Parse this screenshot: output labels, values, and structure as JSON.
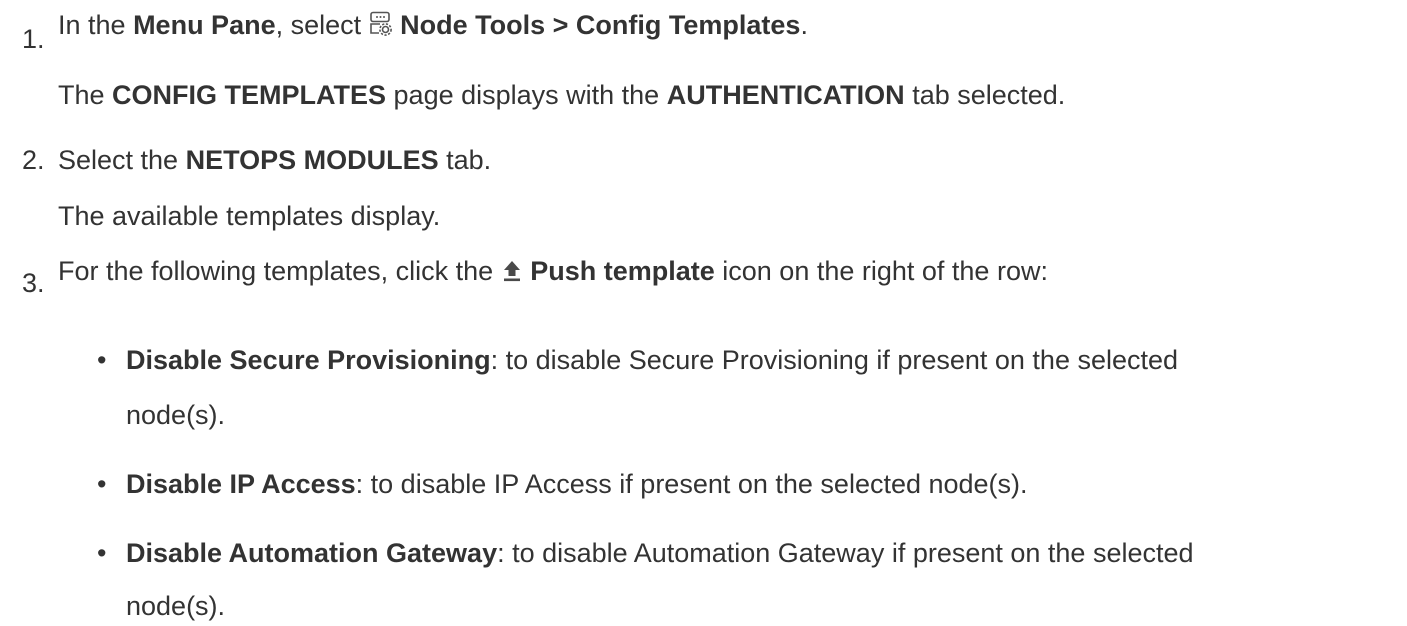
{
  "steps": [
    {
      "number": "1.",
      "line": {
        "pre": "In the ",
        "menu_pane": "Menu Pane",
        "mid": ", select ",
        "menu_path": "Node Tools > Config Templates",
        "post": "."
      },
      "result": {
        "pre": "The ",
        "page": "CONFIG TEMPLATES",
        "mid": " page displays with the ",
        "tab": "AUTHENTICATION",
        "post": " tab selected."
      }
    },
    {
      "number": "2.",
      "line": {
        "pre": "Select the ",
        "tab": "NETOPS MODULES",
        "post": " tab."
      },
      "result": "The available templates display."
    },
    {
      "number": "3.",
      "line": {
        "pre": "For the following templates, click the ",
        "icon_label": "Push template",
        "post": " icon on the right of the row:"
      },
      "bullets": [
        {
          "name": "Disable Secure Provisioning",
          "text1": ": to disable Secure Provisioning if present on the selected",
          "text2": "node(s)."
        },
        {
          "name": "Disable IP Access",
          "text1": ": to disable IP Access if present on the selected node(s).",
          "text2": ""
        },
        {
          "name": "Disable Automation Gateway",
          "text1": ": to disable Automation Gateway if present on the selected",
          "text2": "node(s)."
        }
      ]
    }
  ],
  "icons": {
    "node_tools": "node-tools-icon",
    "push_template": "upload-arrow-icon",
    "bullet": "bullet-dot"
  },
  "colors": {
    "text": "#333333",
    "icon": "#555555",
    "push_icon": "#4a4a4a"
  }
}
